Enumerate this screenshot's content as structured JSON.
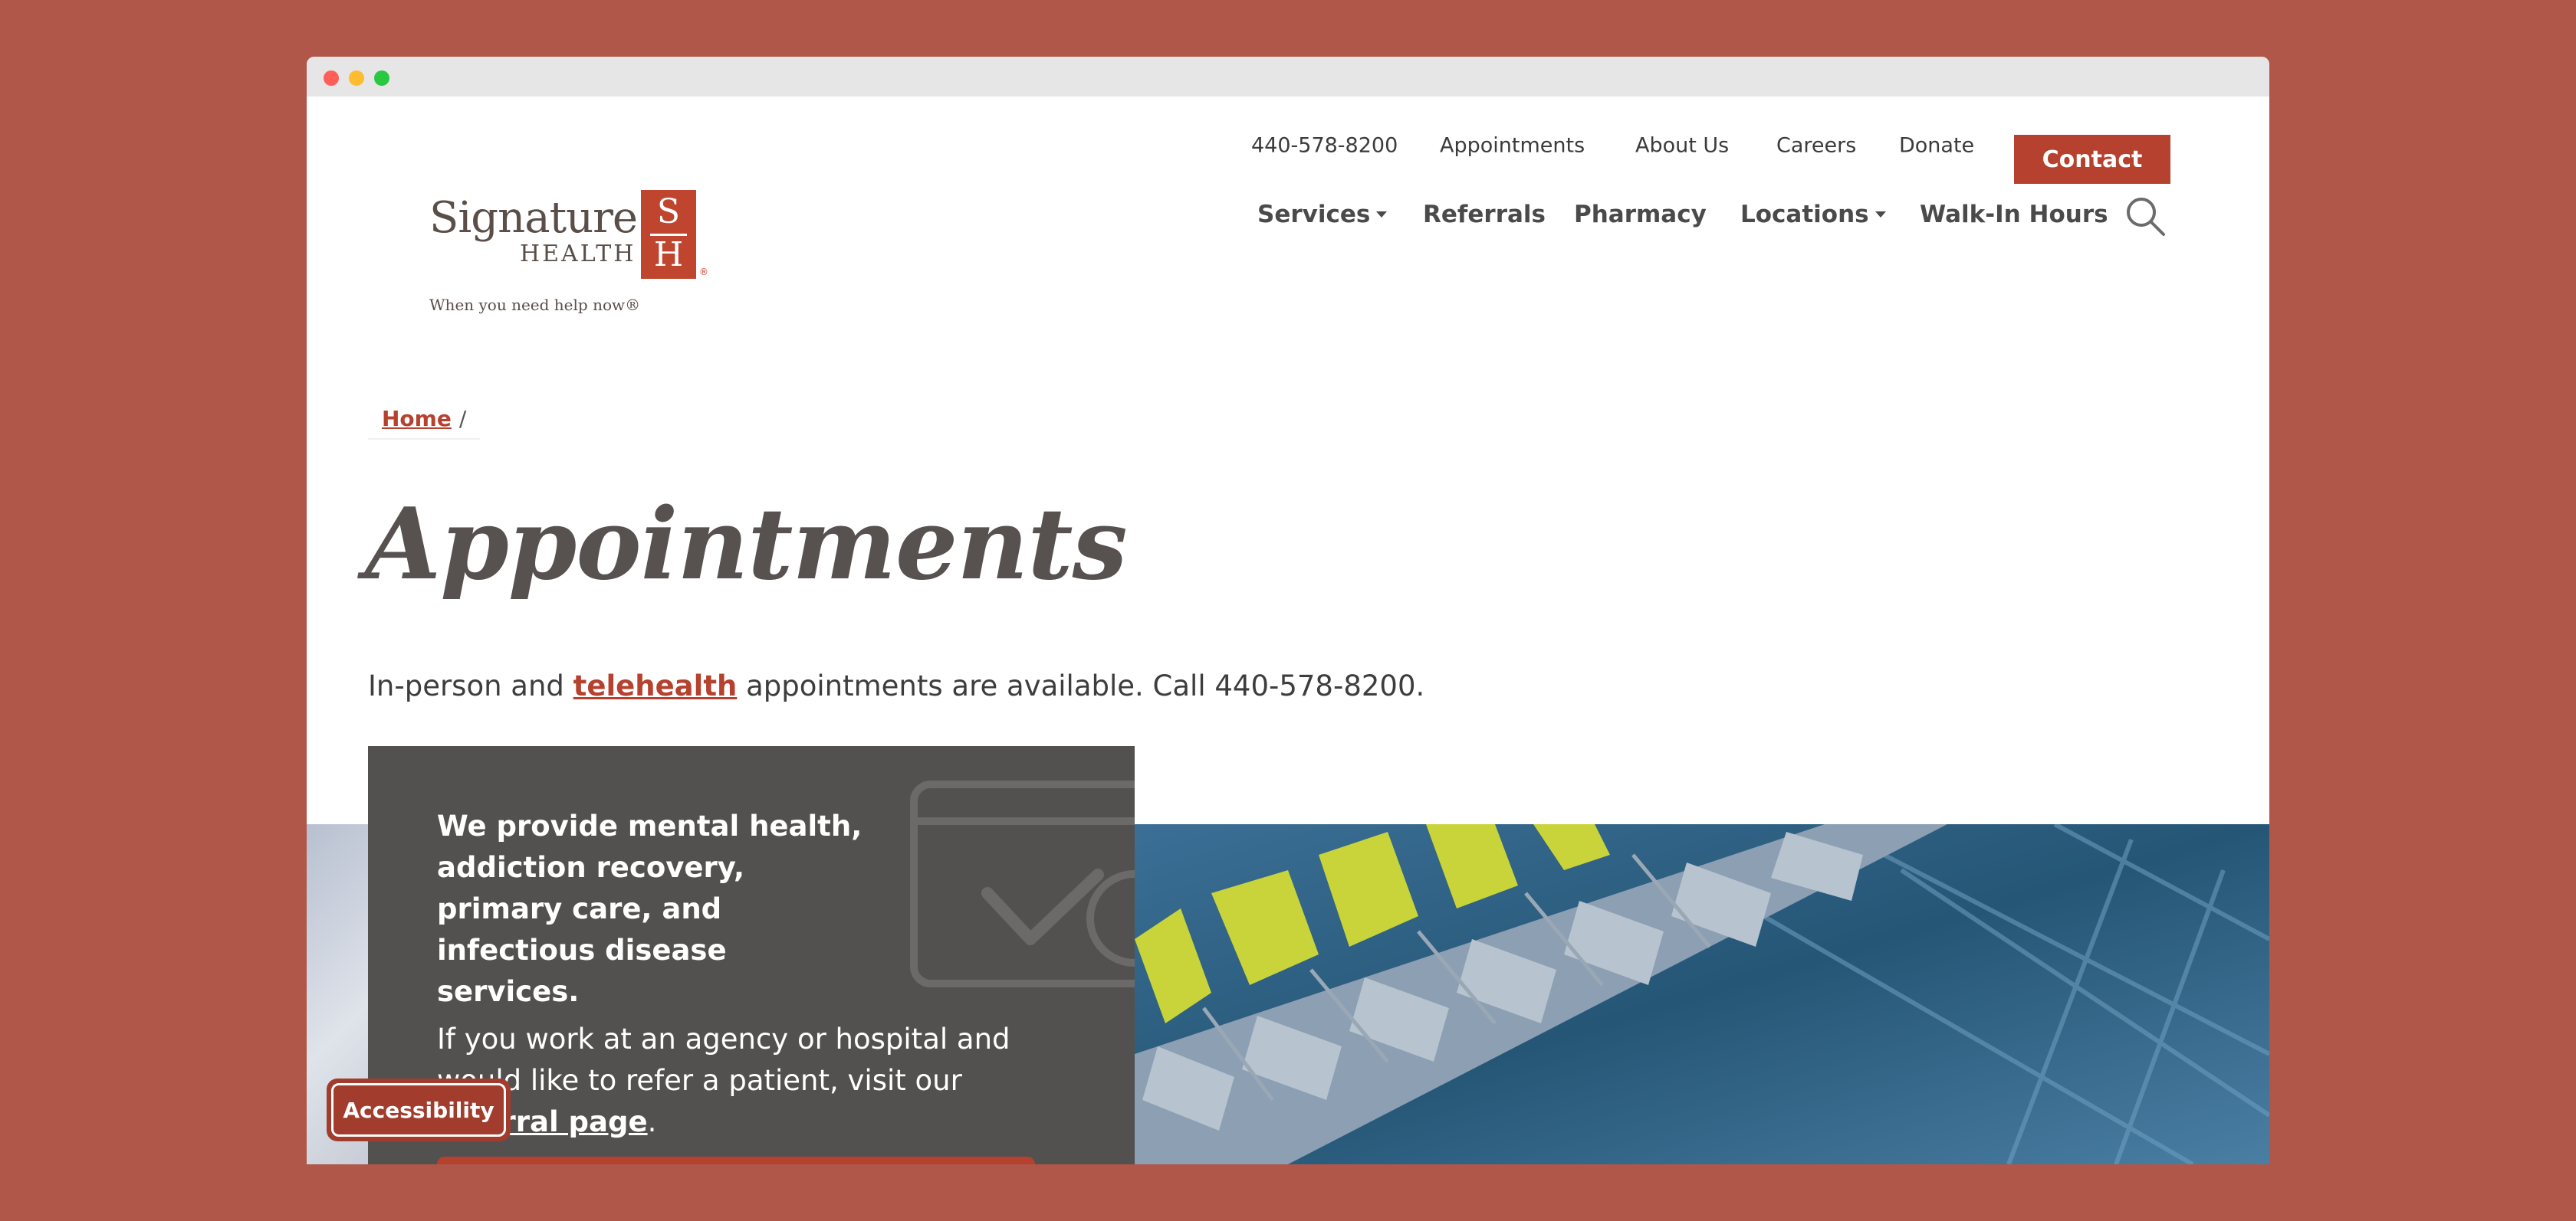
{
  "brand": {
    "name_line1": "Signature",
    "name_line2": "HEALTH",
    "mark_top": "S",
    "mark_bottom": "H",
    "registered": "®",
    "tagline": "When you need help now®",
    "color": "#b5412e"
  },
  "utility_nav": {
    "phone": "440-578-8200",
    "items": [
      "Appointments",
      "About Us",
      "Careers",
      "Donate"
    ],
    "contact_label": "Contact"
  },
  "main_nav": {
    "items": [
      {
        "label": "Services",
        "has_dropdown": true
      },
      {
        "label": "Referrals",
        "has_dropdown": false
      },
      {
        "label": "Pharmacy",
        "has_dropdown": false
      },
      {
        "label": "Locations",
        "has_dropdown": true
      },
      {
        "label": "Walk-In Hours",
        "has_dropdown": false
      }
    ],
    "search_icon": "search-icon"
  },
  "breadcrumb": {
    "home": "Home",
    "separator": "/"
  },
  "page": {
    "title": "Appointments",
    "intro_before": "In-person and ",
    "intro_link": "telehealth",
    "intro_after": " appointments are available. Call 440-578-8200."
  },
  "card": {
    "heading": "We provide mental health, addiction recovery, primary care, and infectious disease services.",
    "body_before": "If you work at an agency or hospital and would like to refer a patient, visit our ",
    "body_link": "referral page",
    "body_after": ".",
    "icon": "calendar-check-icon"
  },
  "accessibility": {
    "label": "Accessibility"
  }
}
